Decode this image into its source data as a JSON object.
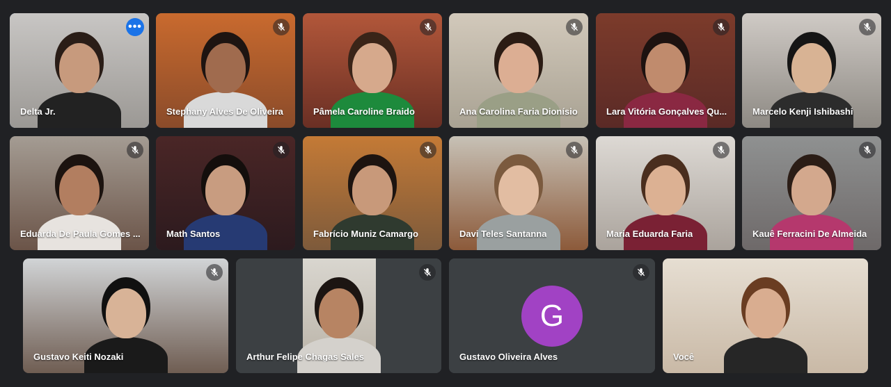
{
  "tiles": [
    {
      "name": "Delta Jr.",
      "muted": false,
      "active": true,
      "menu_glyph": "•••",
      "menu_icon": "more-options-icon",
      "bg": [
        "#c8c6c4",
        "#9b9894"
      ],
      "skin": "#c79a7d",
      "hair": "#2a1d17",
      "shirt": "#222222"
    },
    {
      "name": "Stephany Alves De Oliveira",
      "muted": true,
      "bg": [
        "#c96a2e",
        "#8a4b2a"
      ],
      "skin": "#a06b4e",
      "hair": "#1e1411",
      "shirt": "#d9d9d9"
    },
    {
      "name": "Pâmela Caroline Braido",
      "muted": true,
      "bg": [
        "#b2573a",
        "#6a2f24"
      ],
      "skin": "#d6a98c",
      "hair": "#3a2418",
      "shirt": "#1d8a3c"
    },
    {
      "name": "Ana Carolina Faria Dionísio",
      "muted": true,
      "bg": [
        "#d2c9bb",
        "#a9a293"
      ],
      "skin": "#dcae93",
      "hair": "#2b1c14",
      "shirt": "#9a9f86"
    },
    {
      "name": "Lara Vitória Gonçalves Qu...",
      "muted": true,
      "bg": [
        "#7c3b2b",
        "#5a2a26"
      ],
      "skin": "#c08b6d",
      "hair": "#1d1210",
      "shirt": "#8a2842"
    },
    {
      "name": "Marcelo Kenji Ishibashi",
      "muted": true,
      "bg": [
        "#cfcac5",
        "#8d8983"
      ],
      "skin": "#d8b394",
      "hair": "#151515",
      "shirt": "#2c2c2c"
    },
    {
      "name": "Eduarda De Paula Gomes ...",
      "muted": true,
      "bg": [
        "#a49c93",
        "#6b5448"
      ],
      "skin": "#b27e60",
      "hair": "#1c130f",
      "shirt": "#e7e3df"
    },
    {
      "name": "Math Santos",
      "muted": true,
      "bg": [
        "#4a2626",
        "#2c1a1e"
      ],
      "skin": "#c89c80",
      "hair": "#140e0c",
      "shirt": "#263a73"
    },
    {
      "name": "Fabrício Muniz Camargo",
      "muted": true,
      "bg": [
        "#c47a36",
        "#7d5a3b"
      ],
      "skin": "#c8997a",
      "hair": "#1d1410",
      "shirt": "#2f3a2f"
    },
    {
      "name": "Davi Teles Santanna",
      "muted": true,
      "bg": [
        "#c7c1b6",
        "#8c5a3a"
      ],
      "skin": "#e2bda2",
      "hair": "#7b5a3e",
      "shirt": "#9aa0a0"
    },
    {
      "name": "Maria Eduarda Faria",
      "muted": true,
      "bg": [
        "#ddd9d4",
        "#aaa39c"
      ],
      "skin": "#dcb193",
      "hair": "#4a2e1e",
      "shirt": "#7a2134"
    },
    {
      "name": "Kauê Ferracini De Almeida",
      "muted": true,
      "bg": [
        "#8f9191",
        "#6e6969"
      ],
      "skin": "#d3a88d",
      "hair": "#2b1d16",
      "shirt": "#b5386d"
    },
    {
      "name": "Gustavo Keiti Nozaki",
      "muted": true,
      "bg": [
        "#d1d4d6",
        "#6f5d52"
      ],
      "skin": "#d8b397",
      "hair": "#101010",
      "shirt": "#1a1a1a"
    },
    {
      "name": "Arthur Felipe Chagas Sales",
      "muted": true,
      "strip": true,
      "bg": [
        "#3c4043",
        "#3c4043"
      ],
      "skin": "#b78463",
      "hair": "#1c1512",
      "shirt": "#d4d1cc"
    },
    {
      "name": "Gustavo Oliveira Alves",
      "muted": true,
      "avatar": "G",
      "bg": [
        "#3c4043",
        "#3c4043"
      ]
    },
    {
      "name": "Você",
      "muted": false,
      "bg": [
        "#e6ded2",
        "#c9b9a6"
      ],
      "skin": "#d9ad90",
      "hair": "#6a3d22",
      "shirt": "#262626"
    }
  ],
  "colors": {
    "background": "#202124",
    "active_border": "#8ab4f8",
    "avatar_bg": "#a142c4",
    "more_button": "#1a73e8"
  },
  "icons": {
    "muted": "mic-off-icon"
  }
}
